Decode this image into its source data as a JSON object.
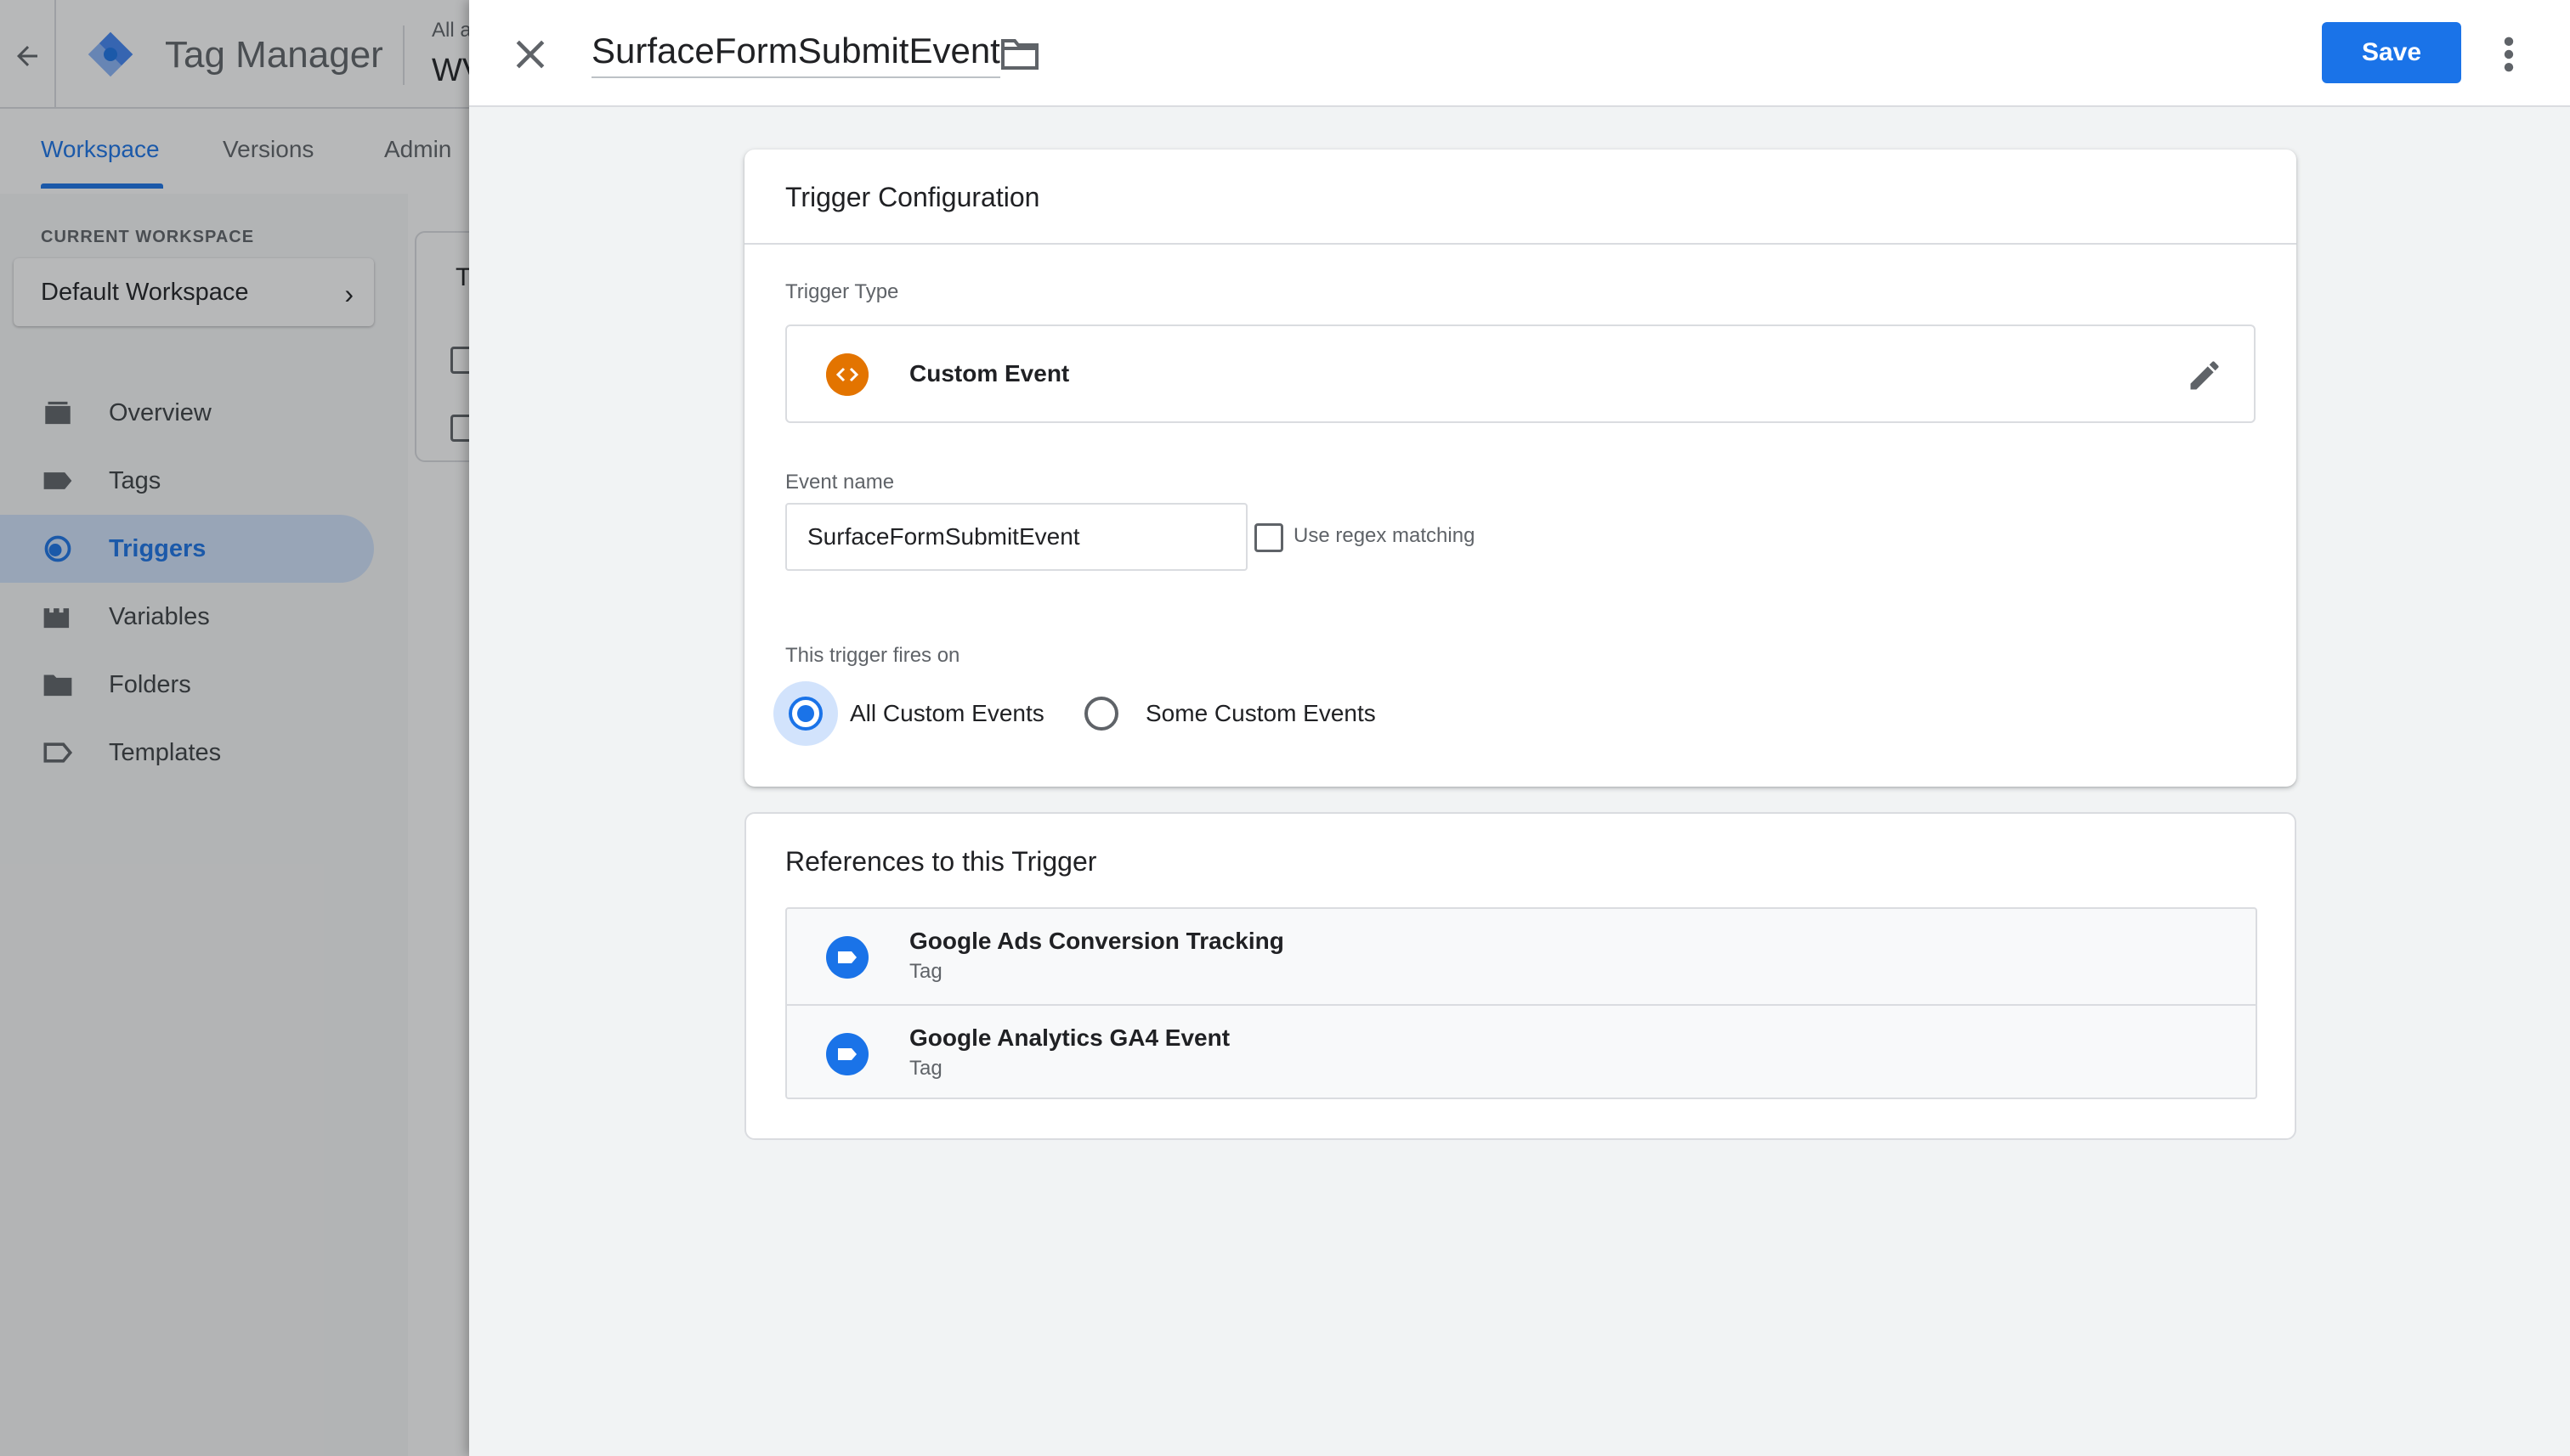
{
  "background": {
    "app_title": "Tag Manager",
    "account_label": "All a",
    "container_name": "WV",
    "tabs": [
      {
        "label": "Workspace"
      },
      {
        "label": "Versions"
      },
      {
        "label": "Admin"
      }
    ],
    "current_workspace_label": "CURRENT WORKSPACE",
    "workspace_name": "Default Workspace",
    "nav": [
      {
        "label": "Overview",
        "icon": "overview-icon"
      },
      {
        "label": "Tags",
        "icon": "tag-icon"
      },
      {
        "label": "Triggers",
        "icon": "trigger-icon",
        "active": true
      },
      {
        "label": "Variables",
        "icon": "variables-icon"
      },
      {
        "label": "Folders",
        "icon": "folder-icon"
      },
      {
        "label": "Templates",
        "icon": "templates-icon"
      }
    ],
    "list_title_fragment": "T"
  },
  "panel": {
    "trigger_name": "SurfaceFormSubmitEvent",
    "save_label": "Save",
    "config": {
      "title": "Trigger Configuration",
      "trigger_type_label": "Trigger Type",
      "trigger_type_value": "Custom Event",
      "event_name_label": "Event name",
      "event_name_value": "SurfaceFormSubmitEvent",
      "regex_label": "Use regex matching",
      "regex_checked": false,
      "fires_on_label": "This trigger fires on",
      "fires_on_options": [
        {
          "label": "All Custom Events",
          "selected": true
        },
        {
          "label": "Some Custom Events",
          "selected": false
        }
      ]
    },
    "references": {
      "title": "References to this Trigger",
      "items": [
        {
          "name": "Google Ads Conversion Tracking",
          "type": "Tag"
        },
        {
          "name": "Google Analytics GA4 Event",
          "type": "Tag"
        }
      ]
    }
  },
  "colors": {
    "primary": "#1a73e8",
    "custom_event_icon": "#e37400",
    "tag_icon": "#1a73e8"
  }
}
